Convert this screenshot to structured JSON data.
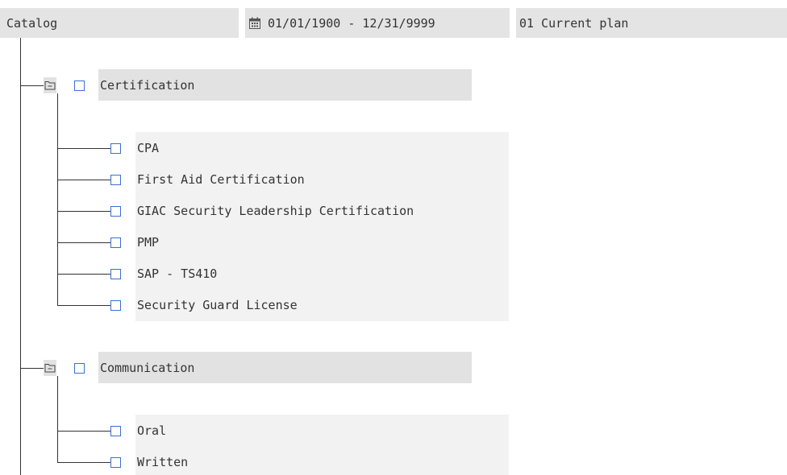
{
  "header": {
    "catalog_label": "Catalog",
    "date_range": "01/01/1900 - 12/31/9999",
    "plan_version": "01 Current plan",
    "calendar_icon": "calendar-icon"
  },
  "groups": [
    {
      "label": "Certification",
      "items": [
        "CPA",
        "First Aid Certification",
        "GIAC Security Leadership Certification",
        "PMP",
        "SAP - TS410",
        "Security Guard License"
      ]
    },
    {
      "label": "Communication",
      "items": [
        "Oral",
        "Written"
      ]
    }
  ],
  "colors": {
    "checkbox_border": "#3a6fd0",
    "header_bg": "#e4e4e4",
    "panel_bg": "#f2f2f2",
    "tree_line": "#333333"
  }
}
